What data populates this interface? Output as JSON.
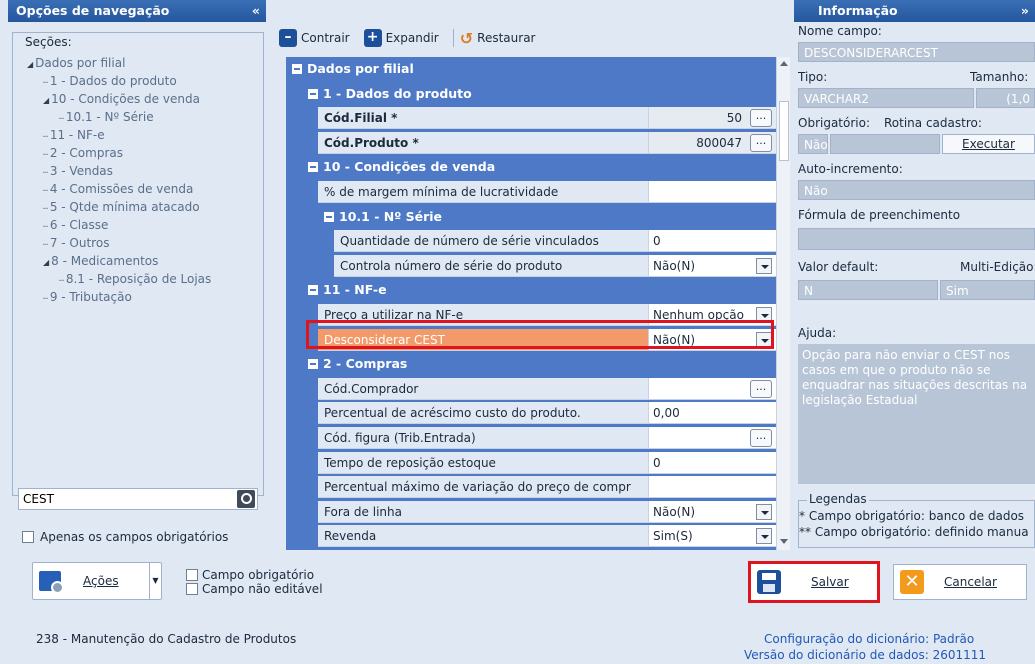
{
  "left": {
    "title": "Opções de navegação",
    "collapse": "«",
    "sections_label": "Seções:",
    "tree": [
      {
        "label": "Dados por filial",
        "level": 0,
        "expanded": true
      },
      {
        "label": "1 - Dados do produto",
        "level": 1
      },
      {
        "label": "10 - Condições de venda",
        "level": 1,
        "expanded": true
      },
      {
        "label": "10.1 - Nº Série",
        "level": 2
      },
      {
        "label": "11 - NF-e",
        "level": 1
      },
      {
        "label": "2 - Compras",
        "level": 1
      },
      {
        "label": "3 - Vendas",
        "level": 1
      },
      {
        "label": "4 - Comissões de venda",
        "level": 1
      },
      {
        "label": "5 - Qtde mínima atacado",
        "level": 1
      },
      {
        "label": "6 - Classe",
        "level": 1
      },
      {
        "label": "7 - Outros",
        "level": 1
      },
      {
        "label": "8 - Medicamentos",
        "level": 1,
        "expanded": true
      },
      {
        "label": "8.1 - Reposição de Lojas",
        "level": 2
      },
      {
        "label": "9 - Tributação",
        "level": 1
      }
    ],
    "search_value": "CEST",
    "only_required": "Apenas os campos obrigatórios"
  },
  "toolbar": {
    "collapse": "Contrair",
    "expand": "Expandir",
    "restore": "Restaurar"
  },
  "grid": {
    "rows": [
      {
        "type": "group",
        "label": "Dados por filial",
        "indent": 0
      },
      {
        "type": "group",
        "label": "1 - Dados do produto",
        "indent": 1
      },
      {
        "type": "field",
        "label": "Cód.Filial *",
        "value": "50",
        "bold": true,
        "gray": true,
        "right": true,
        "ellipsis": true,
        "indent": 2
      },
      {
        "type": "field",
        "label": "Cód.Produto *",
        "value": "800047",
        "bold": true,
        "gray": true,
        "right": true,
        "ellipsis": true,
        "indent": 2
      },
      {
        "type": "group",
        "label": "10 - Condições de venda",
        "indent": 1
      },
      {
        "type": "field",
        "label": "% de margem mínima de lucratividade",
        "value": "",
        "indent": 2
      },
      {
        "type": "group",
        "label": "10.1 - Nº Série",
        "indent": 2
      },
      {
        "type": "field",
        "label": "Quantidade de número de série vinculados",
        "value": "0",
        "indent": 3
      },
      {
        "type": "field",
        "label": "Controla número de série do produto",
        "value": "Não(N)",
        "dropdown": true,
        "indent": 3
      },
      {
        "type": "group",
        "label": "11 - NF-e",
        "indent": 1
      },
      {
        "type": "field",
        "label": "Preço a utilizar na NF-e",
        "value": "Nenhum opção",
        "dropdown": true,
        "indent": 2
      },
      {
        "type": "field",
        "label": "Desconsiderar CEST",
        "value": "Não(N)",
        "dropdown": true,
        "highlight": true,
        "indent": 2
      },
      {
        "type": "group",
        "label": "2 - Compras",
        "indent": 1
      },
      {
        "type": "field",
        "label": "Cód.Comprador",
        "value": "",
        "ellipsis": true,
        "indent": 2
      },
      {
        "type": "field",
        "label": "Percentual de acréscimo custo do produto.",
        "value": "0,00",
        "indent": 2
      },
      {
        "type": "field",
        "label": "Cód. figura (Trib.Entrada)",
        "value": "",
        "ellipsis": true,
        "indent": 2
      },
      {
        "type": "field",
        "label": "Tempo de reposição estoque",
        "value": "0",
        "indent": 2
      },
      {
        "type": "field",
        "label": "Percentual máximo de variação do preço de compr",
        "value": "",
        "indent": 2
      },
      {
        "type": "field",
        "label": "Fora de linha",
        "value": "Não(N)",
        "dropdown": true,
        "indent": 2
      },
      {
        "type": "field",
        "label": "Revenda",
        "value": "Sim(S)",
        "dropdown": true,
        "indent": 2
      }
    ]
  },
  "info": {
    "title": "Informação",
    "collapse": "»",
    "field_name_label": "Nome campo:",
    "field_name": "DESCONSIDERARCEST",
    "type_label": "Tipo:",
    "size_label": "Tamanho:",
    "type": "VARCHAR2",
    "size": "(1,0",
    "required_label": "Obrigatório:",
    "routine_label": "Rotina cadastro:",
    "required": "Não",
    "execute": "Executar",
    "autoinc_label": "Auto-incremento:",
    "autoinc": "Não",
    "formula_label": "Fórmula de preenchimento",
    "default_label": "Valor default:",
    "multi_label": "Multi-Edição:",
    "default": "N",
    "multi": "Sim",
    "help_label": "Ajuda:",
    "help": "Opção para não enviar o CEST nos casos em que o produto não se enquadrar nas situações descritas na legislação Estadual",
    "legend_title": "Legendas",
    "legend_1": "* Campo obrigatório: banco de dados",
    "legend_2": "** Campo obrigatório: definido manua"
  },
  "bottom": {
    "actions": "Ações",
    "check_required": "Campo obrigatório",
    "check_readonly": "Campo não editável",
    "save": "Salvar",
    "cancel": "Cancelar",
    "status": "238 - Manutenção do Cadastro de Produtos",
    "dict_config_label": "Configuração do dicionário:",
    "dict_config": "Padrão",
    "dict_version_label": "Versão do dicionário de dados:",
    "dict_version": "2601111"
  },
  "colors": {
    "header": "#2e63ab",
    "group_row": "#4d79c7",
    "highlight": "#f39a6b",
    "red_border": "#e0141e"
  }
}
